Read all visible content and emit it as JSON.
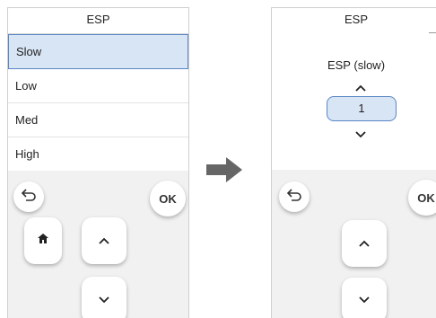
{
  "left_screen": {
    "title": "ESP",
    "options": [
      {
        "label": "Slow",
        "selected": true
      },
      {
        "label": "Low",
        "selected": false
      },
      {
        "label": "Med",
        "selected": false
      },
      {
        "label": "High",
        "selected": false
      }
    ],
    "keypad": {
      "back_icon": "undo-arrow-icon",
      "ok_label": "OK",
      "home_icon": "home-icon",
      "up_icon": "chevron-up-icon",
      "down_icon": "chevron-down-icon"
    }
  },
  "transition_icon": "right-arrow-icon",
  "right_screen": {
    "title": "ESP",
    "setting_label": "ESP (slow)",
    "value": "1",
    "keypad": {
      "back_icon": "undo-arrow-icon",
      "ok_label": "OK",
      "up_icon": "chevron-up-icon",
      "down_icon": "chevron-down-icon"
    }
  },
  "colors": {
    "selection_fill": "#d7e5f5",
    "selection_border": "#5b86c4",
    "keypad_background": "#f1f1f1",
    "arrow": "#666666"
  }
}
